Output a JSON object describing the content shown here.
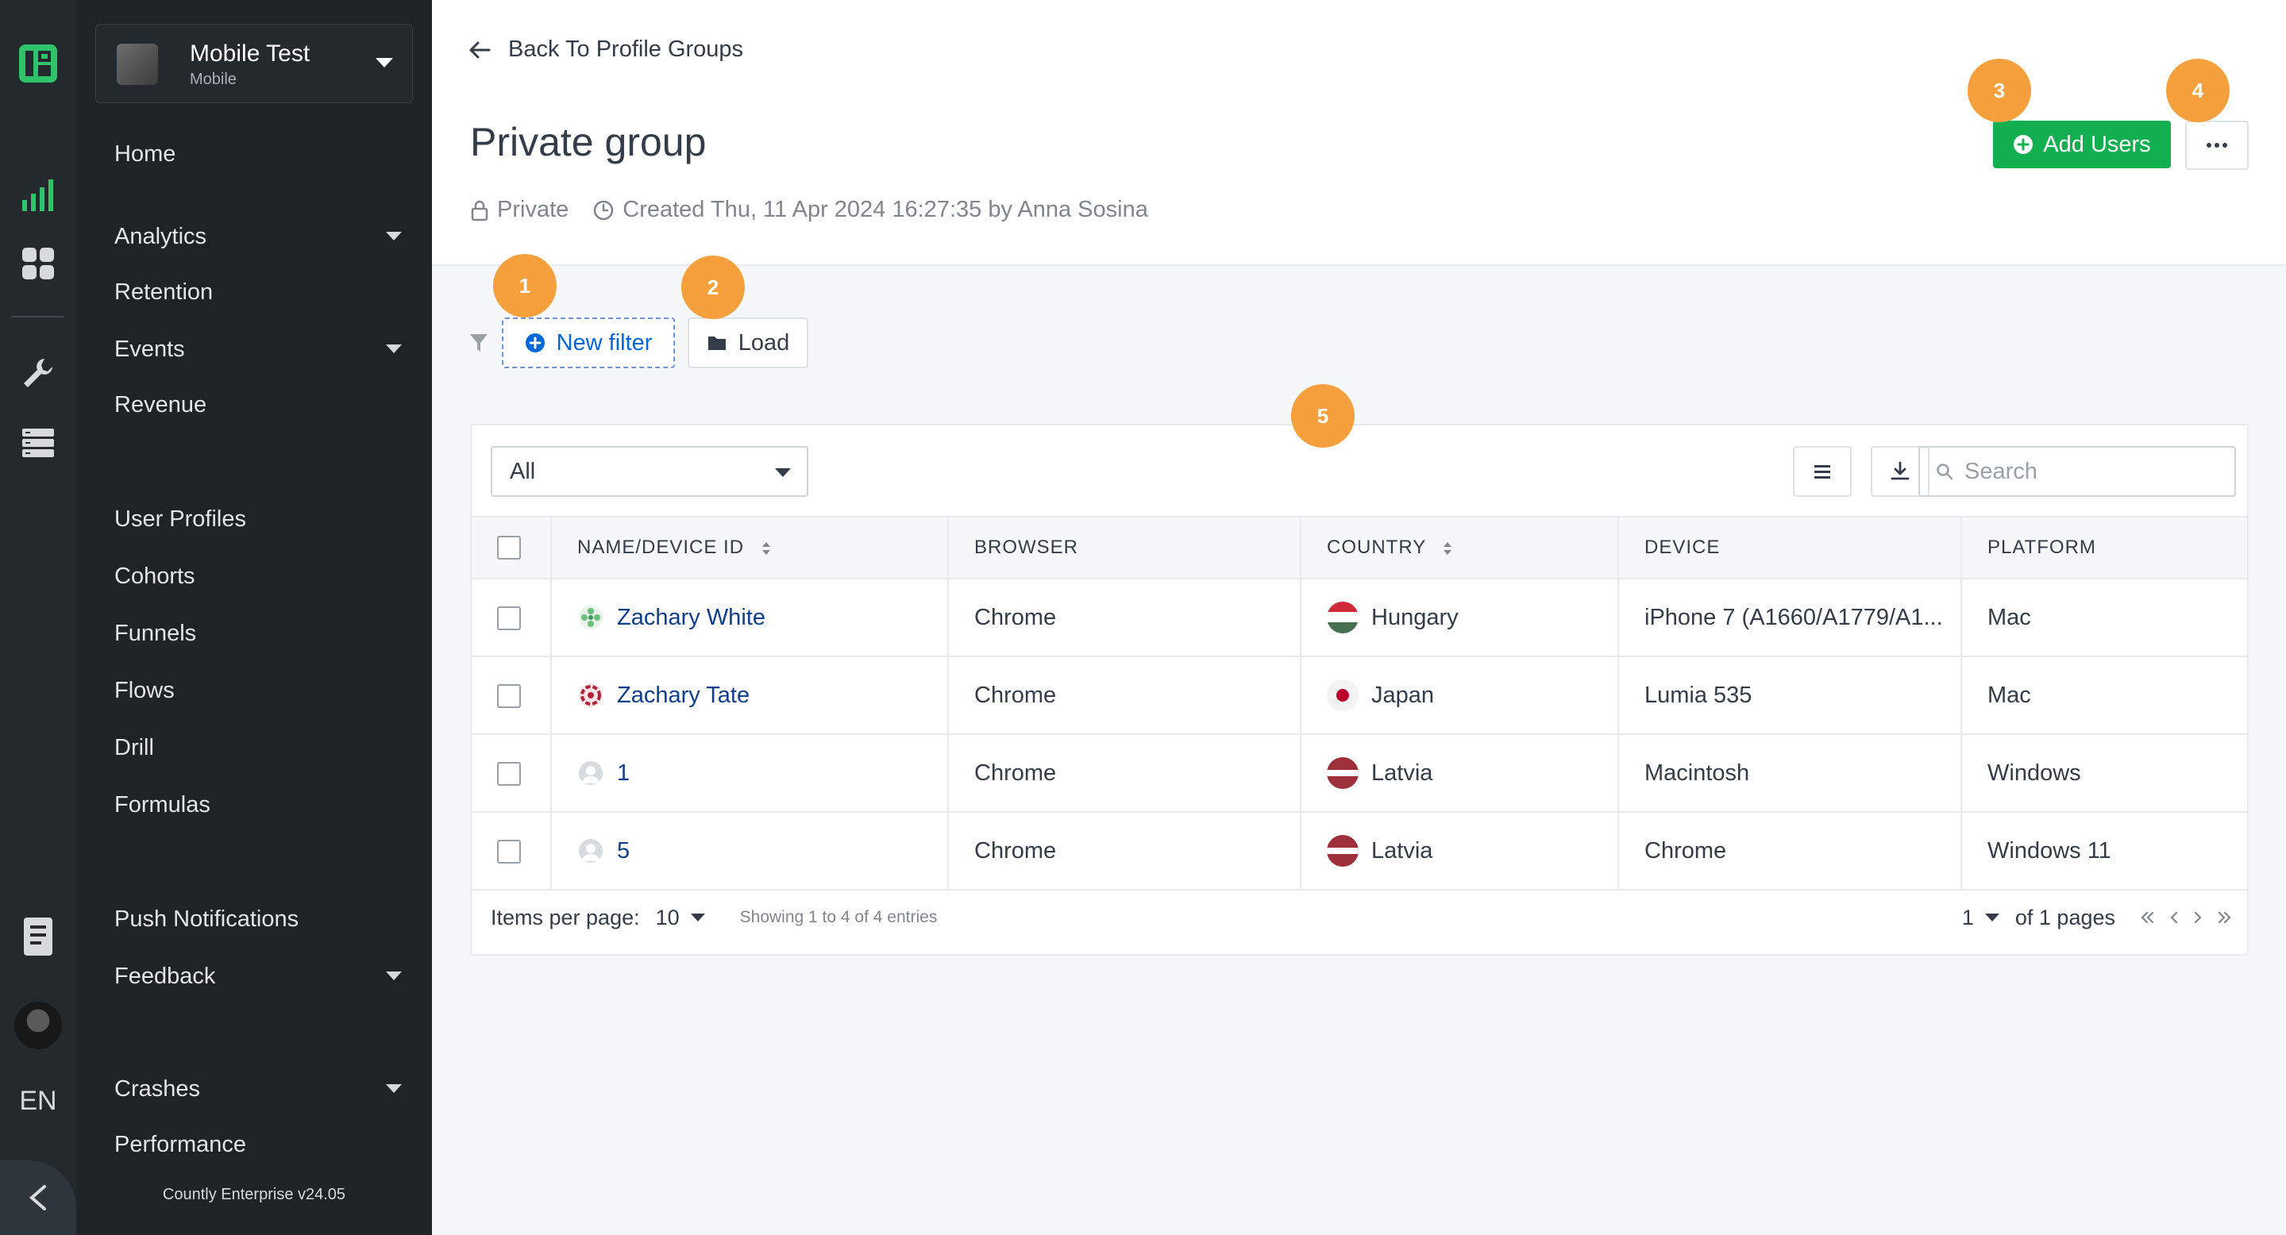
{
  "sidebar": {
    "app_name": "Mobile Test",
    "app_type": "Mobile",
    "items": [
      {
        "label": "Home"
      },
      {
        "label": "Analytics"
      },
      {
        "label": "Retention"
      },
      {
        "label": "Events"
      },
      {
        "label": "Revenue"
      },
      {
        "label": "User Profiles"
      },
      {
        "label": "Cohorts"
      },
      {
        "label": "Funnels"
      },
      {
        "label": "Flows"
      },
      {
        "label": "Drill"
      },
      {
        "label": "Formulas"
      },
      {
        "label": "Push Notifications"
      },
      {
        "label": "Feedback"
      },
      {
        "label": "Crashes"
      },
      {
        "label": "Performance"
      }
    ],
    "version": "Countly Enterprise v24.05",
    "language": "EN"
  },
  "header": {
    "back_label": "Back To Profile Groups",
    "title": "Private group",
    "visibility": "Private",
    "created": "Created Thu, 11 Apr 2024 16:27:35 by Anna Sosina",
    "add_users_label": "Add Users"
  },
  "filters": {
    "new_filter_label": "New filter",
    "load_label": "Load"
  },
  "badges": [
    "1",
    "2",
    "3",
    "4",
    "5"
  ],
  "table": {
    "segment_select": "All",
    "search_placeholder": "Search",
    "columns": [
      "NAME/DEVICE ID",
      "BROWSER",
      "COUNTRY",
      "DEVICE",
      "PLATFORM"
    ],
    "rows": [
      {
        "name": "Zachary White",
        "browser": "Chrome",
        "country": "Hungary",
        "device": "iPhone 7 (A1660/A1779/A1...",
        "platform": "Mac"
      },
      {
        "name": "Zachary Tate",
        "browser": "Chrome",
        "country": "Japan",
        "device": "Lumia 535",
        "platform": "Mac"
      },
      {
        "name": "1",
        "browser": "Chrome",
        "country": "Latvia",
        "device": "Macintosh",
        "platform": "Windows"
      },
      {
        "name": "5",
        "browser": "Chrome",
        "country": "Latvia",
        "device": "Chrome",
        "platform": "Windows 11"
      }
    ]
  },
  "pagination": {
    "items_per_page_label": "Items per page:",
    "items_per_page": "10",
    "showing": "Showing 1 to 4 of 4 entries",
    "current_page": "1",
    "of_pages": "of 1 pages"
  },
  "colors": {
    "accent_green": "#12af51",
    "badge_orange": "#f5a03c",
    "link_blue": "#0166d6"
  }
}
